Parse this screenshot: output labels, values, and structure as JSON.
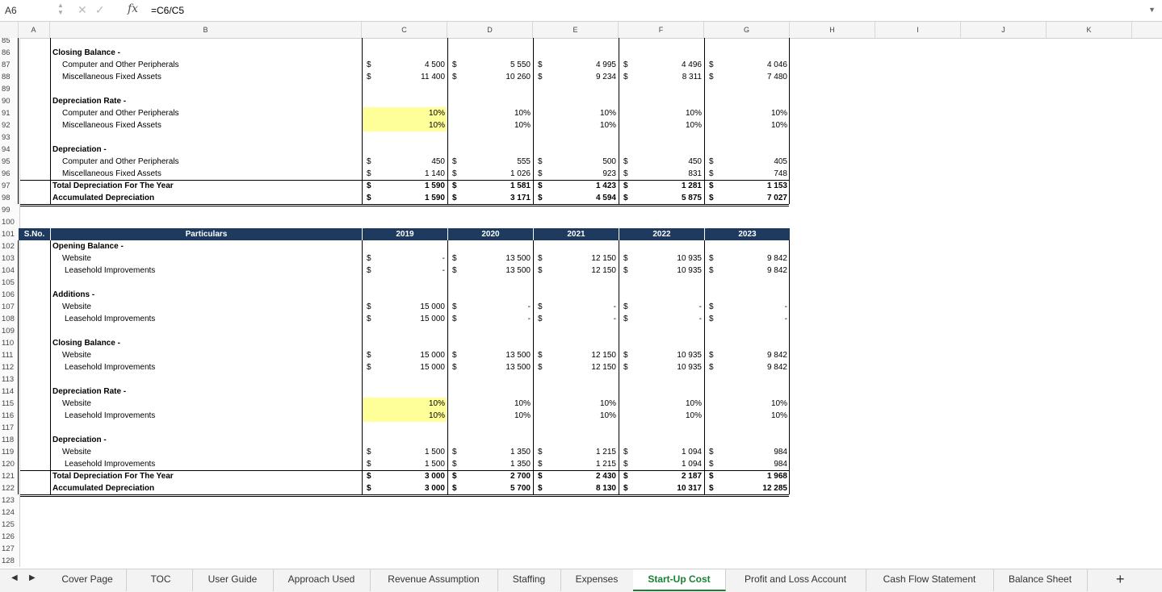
{
  "formula_bar": {
    "cell_ref": "A6",
    "fx_label": "fx",
    "formula": "=C6/C5"
  },
  "columns": [
    "A",
    "B",
    "C",
    "D",
    "E",
    "F",
    "G",
    "H",
    "I",
    "J",
    "K"
  ],
  "table1": {
    "rows": [
      {
        "rn": "85",
        "label": "",
        "style": "",
        "vals": null
      },
      {
        "rn": "86",
        "label": "Closing Balance -",
        "style": "hd",
        "vals": null
      },
      {
        "rn": "87",
        "label": "Computer and Other Peripherals",
        "style": "ind",
        "cur": true,
        "vals": [
          "4 500",
          "5 550",
          "4 995",
          "4 496",
          "4 046"
        ]
      },
      {
        "rn": "88",
        "label": "Miscellaneous Fixed Assets",
        "style": "ind",
        "cur": true,
        "vals": [
          "11 400",
          "10 260",
          "9 234",
          "8 311",
          "7 480"
        ]
      },
      {
        "rn": "89",
        "label": "",
        "style": "",
        "vals": null
      },
      {
        "rn": "90",
        "label": "Depreciation Rate -",
        "style": "hd",
        "vals": null
      },
      {
        "rn": "91",
        "label": "Computer and Other Peripherals",
        "style": "ind",
        "cur": false,
        "yellow": true,
        "vals": [
          "10%",
          "10%",
          "10%",
          "10%",
          "10%"
        ]
      },
      {
        "rn": "92",
        "label": "Miscellaneous Fixed Assets",
        "style": "ind",
        "cur": false,
        "yellow": true,
        "vals": [
          "10%",
          "10%",
          "10%",
          "10%",
          "10%"
        ]
      },
      {
        "rn": "93",
        "label": "",
        "style": "",
        "vals": null
      },
      {
        "rn": "94",
        "label": "Depreciation -",
        "style": "hd",
        "vals": null
      },
      {
        "rn": "95",
        "label": "Computer and Other Peripherals",
        "style": "ind",
        "cur": true,
        "vals": [
          "450",
          "555",
          "500",
          "450",
          "405"
        ]
      },
      {
        "rn": "96",
        "label": "Miscellaneous Fixed Assets",
        "style": "ind",
        "cur": true,
        "vals": [
          "1 140",
          "1 026",
          "923",
          "831",
          "748"
        ]
      },
      {
        "rn": "97",
        "label": "Total Depreciation For The Year",
        "style": "tot",
        "cur": true,
        "bold": true,
        "vals": [
          "1 590",
          "1 581",
          "1 423",
          "1 281",
          "1 153"
        ]
      },
      {
        "rn": "98",
        "label": "Accumulated Depreciation",
        "style": "tot",
        "cur": true,
        "bold": true,
        "vals": [
          "1 590",
          "3 171",
          "4 594",
          "5 875",
          "7 027"
        ]
      },
      {
        "rn": "99",
        "label": "",
        "style": "",
        "vals": null
      },
      {
        "rn": "100",
        "label": "",
        "style": "",
        "vals": null
      }
    ]
  },
  "table2": {
    "header": {
      "rn": "101",
      "sno": "S.No.",
      "particulars": "Particulars",
      "years": [
        "2019",
        "2020",
        "2021",
        "2022",
        "2023"
      ]
    },
    "rows": [
      {
        "rn": "102",
        "label": "Opening Balance -",
        "style": "hd",
        "vals": null
      },
      {
        "rn": "103",
        "label": "Website",
        "style": "ind",
        "cur": true,
        "vals": [
          "-",
          "13 500",
          "12 150",
          "10 935",
          "9 842"
        ]
      },
      {
        "rn": "104",
        "label": "Leasehold Improvements",
        "style": "ind2",
        "cur": true,
        "vals": [
          "-",
          "13 500",
          "12 150",
          "10 935",
          "9 842"
        ]
      },
      {
        "rn": "105",
        "label": "",
        "style": "",
        "vals": null
      },
      {
        "rn": "106",
        "label": "Additions -",
        "style": "hd",
        "vals": null
      },
      {
        "rn": "107",
        "label": "Website",
        "style": "ind",
        "cur": true,
        "vals": [
          "15 000",
          "-",
          "-",
          "-",
          "-"
        ]
      },
      {
        "rn": "108",
        "label": "Leasehold Improvements",
        "style": "ind2",
        "cur": true,
        "vals": [
          "15 000",
          "-",
          "-",
          "-",
          "-"
        ]
      },
      {
        "rn": "109",
        "label": "",
        "style": "",
        "vals": null
      },
      {
        "rn": "110",
        "label": "Closing Balance -",
        "style": "hd",
        "vals": null
      },
      {
        "rn": "111",
        "label": "Website",
        "style": "ind",
        "cur": true,
        "vals": [
          "15 000",
          "13 500",
          "12 150",
          "10 935",
          "9 842"
        ]
      },
      {
        "rn": "112",
        "label": "Leasehold Improvements",
        "style": "ind2",
        "cur": true,
        "vals": [
          "15 000",
          "13 500",
          "12 150",
          "10 935",
          "9 842"
        ]
      },
      {
        "rn": "113",
        "label": "",
        "style": "",
        "vals": null
      },
      {
        "rn": "114",
        "label": "Depreciation Rate -",
        "style": "hd",
        "vals": null
      },
      {
        "rn": "115",
        "label": "Website",
        "style": "ind",
        "cur": false,
        "yellow": true,
        "vals": [
          "10%",
          "10%",
          "10%",
          "10%",
          "10%"
        ]
      },
      {
        "rn": "116",
        "label": "Leasehold Improvements",
        "style": "ind2",
        "cur": false,
        "yellow": true,
        "vals": [
          "10%",
          "10%",
          "10%",
          "10%",
          "10%"
        ]
      },
      {
        "rn": "117",
        "label": "",
        "style": "",
        "vals": null
      },
      {
        "rn": "118",
        "label": "Depreciation -",
        "style": "hd",
        "vals": null
      },
      {
        "rn": "119",
        "label": "Website",
        "style": "ind",
        "cur": true,
        "vals": [
          "1 500",
          "1 350",
          "1 215",
          "1 094",
          "984"
        ]
      },
      {
        "rn": "120",
        "label": "Leasehold Improvements",
        "style": "ind2",
        "cur": true,
        "vals": [
          "1 500",
          "1 350",
          "1 215",
          "1 094",
          "984"
        ]
      },
      {
        "rn": "121",
        "label": "Total Depreciation For The Year",
        "style": "tot",
        "cur": true,
        "bold": true,
        "vals": [
          "3 000",
          "2 700",
          "2 430",
          "2 187",
          "1 968"
        ]
      },
      {
        "rn": "122",
        "label": "Accumulated Depreciation",
        "style": "tot",
        "cur": true,
        "bold": true,
        "vals": [
          "3 000",
          "5 700",
          "8 130",
          "10 317",
          "12 285"
        ]
      },
      {
        "rn": "123",
        "label": "",
        "style": "",
        "vals": null
      },
      {
        "rn": "124",
        "label": "",
        "style": "",
        "vals": null
      },
      {
        "rn": "125",
        "label": "",
        "style": "",
        "vals": null
      },
      {
        "rn": "126",
        "label": "",
        "style": "",
        "vals": null
      },
      {
        "rn": "127",
        "label": "",
        "style": "",
        "vals": null
      },
      {
        "rn": "128",
        "label": "",
        "style": "",
        "vals": null
      }
    ]
  },
  "currency_symbol": "$",
  "sheet_tabs": [
    "Cover Page",
    "TOC",
    "User Guide",
    "Approach Used",
    "Revenue Assumption",
    "Staffing",
    "Expenses",
    "Start-Up Cost",
    "Profit and Loss Account",
    "Cash Flow Statement",
    "Balance Sheet"
  ],
  "active_tab": "Start-Up Cost",
  "colors": {
    "header_fill": "#1f3a5f",
    "highlight": "#ffff99",
    "active_tab_text": "#1a7f37"
  }
}
